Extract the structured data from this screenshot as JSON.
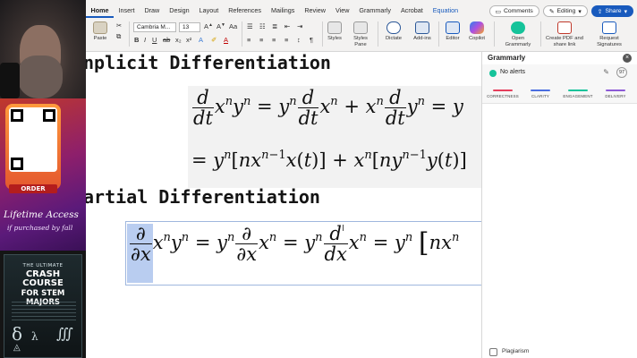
{
  "promo": {
    "order_label": "ORDER",
    "lifetime": "Lifetime Access",
    "fall": "if purchased by fall",
    "book_top": "THE ULTIMATE",
    "book_title": "CRASH COURSE",
    "book_sub": "FOR STEM MAJORS"
  },
  "ribbon": {
    "tabs": [
      "Home",
      "Insert",
      "Draw",
      "Design",
      "Layout",
      "References",
      "Mailings",
      "Review",
      "View",
      "Grammarly",
      "Acrobat",
      "Equation"
    ],
    "active_tab": "Home",
    "comments_label": "Comments",
    "editing_label": "Editing",
    "share_label": "Share",
    "paste_label": "Paste",
    "font_name": "Cambria M...",
    "font_size": "13",
    "styles_label": "Styles",
    "styles_pane_label": "Styles Pane",
    "dictate_label": "Dictate",
    "addins_label": "Add-ins",
    "editor_label": "Editor",
    "copilot_label": "Copilot",
    "open_grammarly_label": "Open Grammarly",
    "create_pdf_label": "Create PDF and share link",
    "request_sig_label": "Request Signatures"
  },
  "document": {
    "heading1": "nplicit Differentiation",
    "heading2": "artial Differentiation"
  },
  "grammarly": {
    "title": "Grammarly",
    "alerts": "No alerts",
    "score": "97",
    "categories": [
      {
        "label": "CORRECTNESS",
        "color": "#e53f5c"
      },
      {
        "label": "CLARITY",
        "color": "#4a6ee0"
      },
      {
        "label": "ENGAGEMENT",
        "color": "#15c39a"
      },
      {
        "label": "DELIVERY",
        "color": "#8c5ad6"
      }
    ],
    "plagiarism": "Plagiarism"
  }
}
